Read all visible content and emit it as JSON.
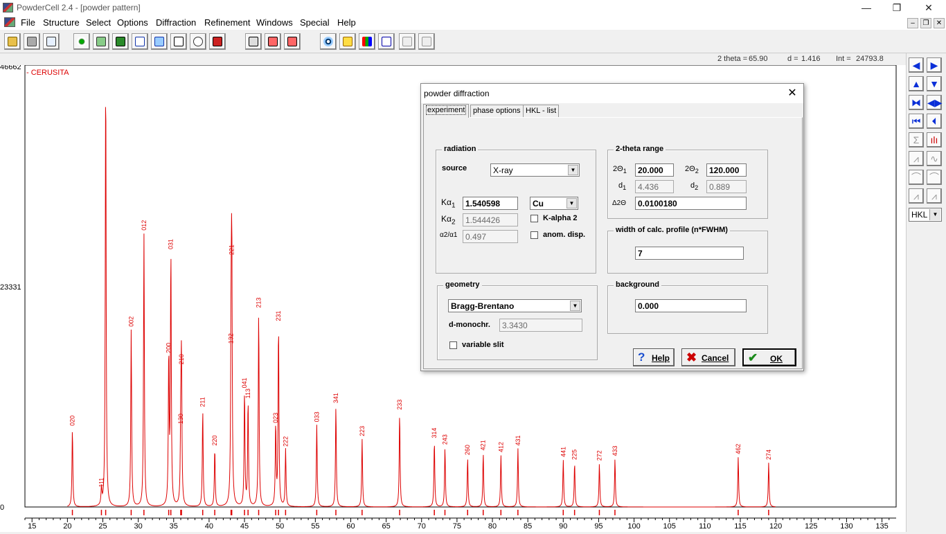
{
  "window": {
    "title": "PowderCell 2.4 - [powder pattern]"
  },
  "menu": [
    "File",
    "Structure",
    "Select",
    "Options",
    "Diffraction",
    "Refinement",
    "Windows",
    "Special",
    "Help"
  ],
  "status": {
    "twotheta_label": "2 theta = ",
    "twotheta": "65.90",
    "d_label": "d = ",
    "d": "1.416",
    "int_label": "Int = ",
    "int": "24793.8"
  },
  "plot": {
    "phase_label": "- CERUSITA",
    "y_ticks": [
      "46662",
      "23331",
      "0"
    ],
    "x_ticks": [
      "15",
      "20",
      "25",
      "30",
      "35",
      "40",
      "45",
      "50",
      "55",
      "60",
      "65",
      "70",
      "75",
      "80",
      "85",
      "90",
      "95",
      "100",
      "105",
      "110",
      "115",
      "120",
      "125",
      "130",
      "135"
    ],
    "line_color": "#dd0000"
  },
  "chart_data": {
    "type": "line",
    "x_range": [
      14,
      137
    ],
    "y_range": [
      0,
      46662
    ],
    "series": [
      {
        "name": "CERUSITA",
        "peaks": [
          {
            "x": 20.7,
            "y": 8300,
            "hkl": "020"
          },
          {
            "x": 25.4,
            "y": 46662,
            "hkl": ""
          },
          {
            "x": 24.8,
            "y": 1800,
            "hkl": "111"
          },
          {
            "x": 29.0,
            "y": 18800,
            "hkl": "002"
          },
          {
            "x": 30.8,
            "y": 29000,
            "hkl": "012"
          },
          {
            "x": 34.6,
            "y": 27000,
            "hkl": "031"
          },
          {
            "x": 34.3,
            "y": 16000,
            "hkl": "200"
          },
          {
            "x": 36.1,
            "y": 14800,
            "hkl": "210"
          },
          {
            "x": 36.0,
            "y": 8500,
            "hkl": "130"
          },
          {
            "x": 39.1,
            "y": 10300,
            "hkl": "211"
          },
          {
            "x": 40.8,
            "y": 6200,
            "hkl": "220"
          },
          {
            "x": 43.2,
            "y": 26400,
            "hkl": "221"
          },
          {
            "x": 43.1,
            "y": 17000,
            "hkl": "132"
          },
          {
            "x": 45.0,
            "y": 12300,
            "hkl": "041"
          },
          {
            "x": 45.5,
            "y": 11200,
            "hkl": "113"
          },
          {
            "x": 47.0,
            "y": 20800,
            "hkl": "213"
          },
          {
            "x": 49.8,
            "y": 19400,
            "hkl": "231"
          },
          {
            "x": 49.4,
            "y": 8600,
            "hkl": "023"
          },
          {
            "x": 50.8,
            "y": 6100,
            "hkl": "222"
          },
          {
            "x": 55.2,
            "y": 8700,
            "hkl": "033"
          },
          {
            "x": 57.9,
            "y": 10700,
            "hkl": "341"
          },
          {
            "x": 61.6,
            "y": 7200,
            "hkl": "223"
          },
          {
            "x": 66.9,
            "y": 10000,
            "hkl": "233"
          },
          {
            "x": 71.8,
            "y": 7000,
            "hkl": "314"
          },
          {
            "x": 73.3,
            "y": 6300,
            "hkl": "243"
          },
          {
            "x": 76.5,
            "y": 5200,
            "hkl": "260"
          },
          {
            "x": 78.7,
            "y": 5700,
            "hkl": "421"
          },
          {
            "x": 81.2,
            "y": 5500,
            "hkl": "412"
          },
          {
            "x": 83.6,
            "y": 6200,
            "hkl": "431"
          },
          {
            "x": 90.0,
            "y": 5000,
            "hkl": "441"
          },
          {
            "x": 91.6,
            "y": 4700,
            "hkl": "225"
          },
          {
            "x": 95.1,
            "y": 4600,
            "hkl": "272"
          },
          {
            "x": 97.3,
            "y": 5100,
            "hkl": "433"
          },
          {
            "x": 114.7,
            "y": 5300,
            "hkl": "462"
          },
          {
            "x": 119.0,
            "y": 4700,
            "hkl": "274"
          }
        ]
      }
    ]
  },
  "sidebar": {
    "hkl_select": "HKL"
  },
  "dialog": {
    "title": "powder diffraction",
    "tabs": [
      "experiment",
      "phase options",
      "HKL - list"
    ],
    "radiation": {
      "title": "radiation",
      "source_label": "source",
      "source": "X-ray",
      "ka1_label": "Kα",
      "ka1_sub": "1",
      "ka1": "1.540598",
      "ka2_label": "Kα",
      "ka2_sub": "2",
      "ka2": "1.544426",
      "ratio_label": "α2/α1",
      "ratio": "0.497",
      "anode": "Cu",
      "kalpha2_label": "K-alpha 2",
      "anom_label": "anom. disp."
    },
    "range": {
      "title": "2-theta range",
      "t1_label": "2Θ",
      "t1_sub": "1",
      "t1": "20.000",
      "t2_label": "2Θ",
      "t2_sub": "2",
      "t2": "120.000",
      "d1_label": "d",
      "d1_sub": "1",
      "d1": "4.436",
      "d2_label": "d",
      "d2_sub": "2",
      "d2": "0.889",
      "step_label": "Δ2Θ",
      "step": "0.0100180"
    },
    "width": {
      "title": "width of calc. profile  (n*FWHM)",
      "value": "7"
    },
    "geometry": {
      "title": "geometry",
      "value": "Bragg-Brentano",
      "dmono_label": "d-monochr.",
      "dmono": "3.3430",
      "varslit_label": "variable slit"
    },
    "background": {
      "title": "background",
      "value": "0.000"
    },
    "buttons": {
      "help": "Help",
      "cancel": "Cancel",
      "ok": "OK"
    }
  }
}
